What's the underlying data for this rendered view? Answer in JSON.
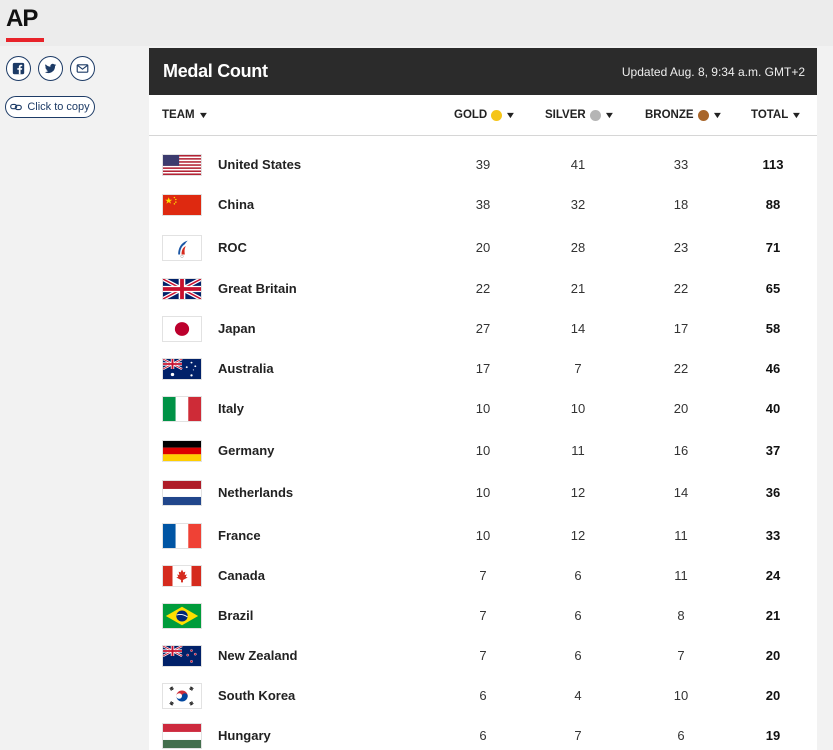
{
  "logo": {
    "text": "AP"
  },
  "share": {
    "copy_label": "Click to copy"
  },
  "panel": {
    "title": "Medal Count",
    "updated": "Updated Aug. 8, 9:34 a.m. GMT+2"
  },
  "columns": {
    "team": "TEAM",
    "gold": "GOLD",
    "silver": "SILVER",
    "bronze": "BRONZE",
    "total": "TOTAL"
  },
  "colors": {
    "gold": "#f5c518",
    "silver": "#b5b5b5",
    "bronze": "#a8652a",
    "ap_red": "#e8232a",
    "header_bg": "#2b2b2b",
    "share_blue": "#1d3b66"
  },
  "rows": [
    {
      "flag": "flag-united-states",
      "team": "United States",
      "gold": "39",
      "silver": "41",
      "bronze": "33",
      "total": "113"
    },
    {
      "flag": "flag-china",
      "team": "China",
      "gold": "38",
      "silver": "32",
      "bronze": "18",
      "total": "88"
    },
    {
      "flag": "flag-roc",
      "team": "ROC",
      "gold": "20",
      "silver": "28",
      "bronze": "23",
      "total": "71"
    },
    {
      "flag": "flag-great-britain",
      "team": "Great Britain",
      "gold": "22",
      "silver": "21",
      "bronze": "22",
      "total": "65"
    },
    {
      "flag": "flag-japan",
      "team": "Japan",
      "gold": "27",
      "silver": "14",
      "bronze": "17",
      "total": "58"
    },
    {
      "flag": "flag-australia",
      "team": "Australia",
      "gold": "17",
      "silver": "7",
      "bronze": "22",
      "total": "46"
    },
    {
      "flag": "flag-italy",
      "team": "Italy",
      "gold": "10",
      "silver": "10",
      "bronze": "20",
      "total": "40"
    },
    {
      "flag": "flag-germany",
      "team": "Germany",
      "gold": "10",
      "silver": "11",
      "bronze": "16",
      "total": "37"
    },
    {
      "flag": "flag-netherlands",
      "team": "Netherlands",
      "gold": "10",
      "silver": "12",
      "bronze": "14",
      "total": "36"
    },
    {
      "flag": "flag-france",
      "team": "France",
      "gold": "10",
      "silver": "12",
      "bronze": "11",
      "total": "33"
    },
    {
      "flag": "flag-canada",
      "team": "Canada",
      "gold": "7",
      "silver": "6",
      "bronze": "11",
      "total": "24"
    },
    {
      "flag": "flag-brazil",
      "team": "Brazil",
      "gold": "7",
      "silver": "6",
      "bronze": "8",
      "total": "21"
    },
    {
      "flag": "flag-new-zealand",
      "team": "New Zealand",
      "gold": "7",
      "silver": "6",
      "bronze": "7",
      "total": "20"
    },
    {
      "flag": "flag-south-korea",
      "team": "South Korea",
      "gold": "6",
      "silver": "4",
      "bronze": "10",
      "total": "20"
    },
    {
      "flag": "flag-hungary",
      "team": "Hungary",
      "gold": "6",
      "silver": "7",
      "bronze": "6",
      "total": "19"
    }
  ]
}
